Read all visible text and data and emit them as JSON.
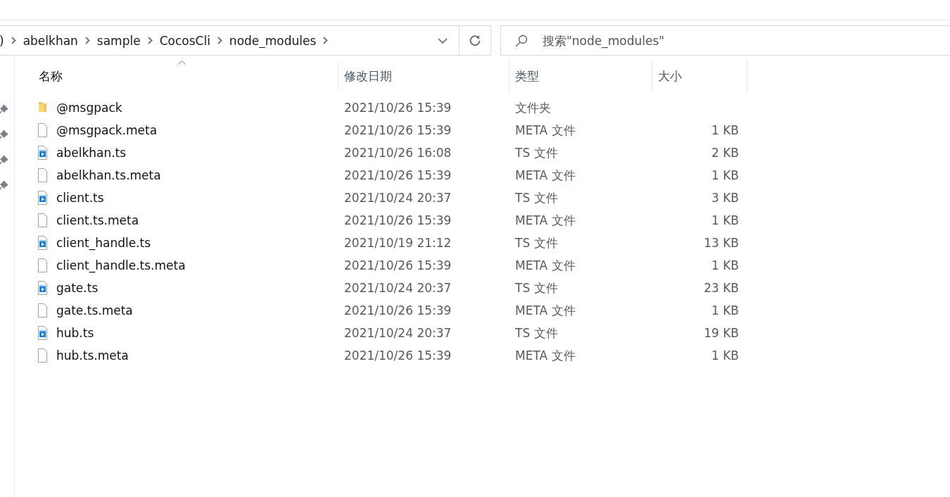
{
  "breadcrumb": [
    ")",
    "abelkhan",
    "sample",
    "CocosCli",
    "node_modules"
  ],
  "search": {
    "placeholder": "搜索\"node_modules\""
  },
  "columns": [
    {
      "label": "名称",
      "sorted": true
    },
    {
      "label": "修改日期",
      "sorted": false
    },
    {
      "label": "类型",
      "sorted": false
    },
    {
      "label": "大小",
      "sorted": false
    }
  ],
  "rows": [
    {
      "kind": "folder",
      "name": "@msgpack",
      "date": "2021/10/26 15:39",
      "type": "文件夹"
    },
    {
      "kind": "file",
      "name": "@msgpack.meta",
      "date": "2021/10/26 15:39",
      "type": "META 文件",
      "size": "1 KB"
    },
    {
      "kind": "ts",
      "name": "abelkhan.ts",
      "date": "2021/10/26 16:08",
      "type": "TS 文件",
      "size": "2 KB"
    },
    {
      "kind": "file",
      "name": "abelkhan.ts.meta",
      "date": "2021/10/26 15:39",
      "type": "META 文件",
      "size": "1 KB"
    },
    {
      "kind": "ts",
      "name": "client.ts",
      "date": "2021/10/24 20:37",
      "type": "TS 文件",
      "size": "3 KB"
    },
    {
      "kind": "file",
      "name": "client.ts.meta",
      "date": "2021/10/26 15:39",
      "type": "META 文件",
      "size": "1 KB"
    },
    {
      "kind": "ts",
      "name": "client_handle.ts",
      "date": "2021/10/19 21:12",
      "type": "TS 文件",
      "size": "13 KB"
    },
    {
      "kind": "file",
      "name": "client_handle.ts.meta",
      "date": "2021/10/26 15:39",
      "type": "META 文件",
      "size": "1 KB"
    },
    {
      "kind": "ts",
      "name": "gate.ts",
      "date": "2021/10/24 20:37",
      "type": "TS 文件",
      "size": "23 KB"
    },
    {
      "kind": "file",
      "name": "gate.ts.meta",
      "date": "2021/10/26 15:39",
      "type": "META 文件",
      "size": "1 KB"
    },
    {
      "kind": "ts",
      "name": "hub.ts",
      "date": "2021/10/24 20:37",
      "type": "TS 文件",
      "size": "19 KB"
    },
    {
      "kind": "file",
      "name": "hub.ts.meta",
      "date": "2021/10/26 15:39",
      "type": "META 文件",
      "size": "1 KB"
    }
  ]
}
